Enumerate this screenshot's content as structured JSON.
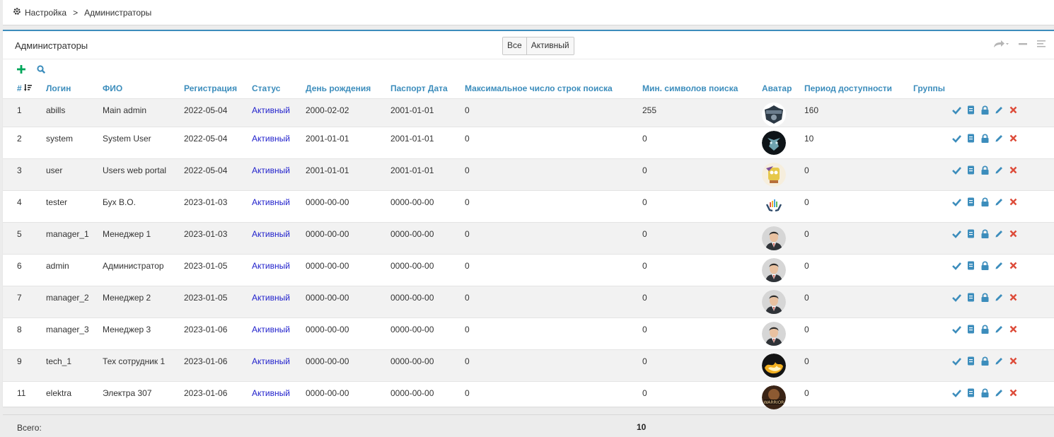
{
  "breadcrumb": {
    "root": "Настройка",
    "separator": ">",
    "current": "Администраторы"
  },
  "card": {
    "title": "Администраторы"
  },
  "filters": [
    {
      "label": "Все"
    },
    {
      "label": "Активный"
    }
  ],
  "columns": {
    "id": "#",
    "login": "Логин",
    "fio": "ФИО",
    "reg": "Регистрация",
    "status": "Статус",
    "birthday": "День рождения",
    "passport": "Паспорт Дата",
    "max_rows": "Максимальное число строк поиска",
    "min_chars": "Мин. символов поиска",
    "avatar": "Аватар",
    "period": "Период доступности",
    "groups": "Группы"
  },
  "rows": [
    {
      "id": "1",
      "login": "abills",
      "fio": "Main admin",
      "reg": "2022-05-04",
      "status": "Активный",
      "birthday": "2000-02-02",
      "passport": "2001-01-01",
      "max_rows": "0",
      "min_chars": "255",
      "avatar": "logo-avatar",
      "period": "160",
      "groups": ""
    },
    {
      "id": "2",
      "login": "system",
      "fio": "System User",
      "reg": "2022-05-04",
      "status": "Активный",
      "birthday": "2001-01-01",
      "passport": "2001-01-01",
      "max_rows": "0",
      "min_chars": "0",
      "avatar": "monster-avatar",
      "period": "10",
      "groups": ""
    },
    {
      "id": "3",
      "login": "user",
      "fio": "Users web portal",
      "reg": "2022-05-04",
      "status": "Активный",
      "birthday": "2001-01-01",
      "passport": "2001-01-01",
      "max_rows": "0",
      "min_chars": "0",
      "avatar": "sponge-avatar",
      "period": "0",
      "groups": ""
    },
    {
      "id": "4",
      "login": "tester",
      "fio": "Бух В.О.",
      "reg": "2023-01-03",
      "status": "Активный",
      "birthday": "0000-00-00",
      "passport": "0000-00-00",
      "max_rows": "0",
      "min_chars": "0",
      "avatar": "hands-avatar",
      "period": "0",
      "groups": ""
    },
    {
      "id": "5",
      "login": "manager_1",
      "fio": "Менеджер 1",
      "reg": "2023-01-03",
      "status": "Активный",
      "birthday": "0000-00-00",
      "passport": "0000-00-00",
      "max_rows": "0",
      "min_chars": "0",
      "avatar": "man-avatar",
      "period": "0",
      "groups": ""
    },
    {
      "id": "6",
      "login": "admin",
      "fio": "Администратор",
      "reg": "2023-01-05",
      "status": "Активный",
      "birthday": "0000-00-00",
      "passport": "0000-00-00",
      "max_rows": "0",
      "min_chars": "0",
      "avatar": "man-avatar",
      "period": "0",
      "groups": ""
    },
    {
      "id": "7",
      "login": "manager_2",
      "fio": "Менеджер 2",
      "reg": "2023-01-05",
      "status": "Активный",
      "birthday": "0000-00-00",
      "passport": "0000-00-00",
      "max_rows": "0",
      "min_chars": "0",
      "avatar": "man-avatar",
      "period": "0",
      "groups": ""
    },
    {
      "id": "8",
      "login": "manager_3",
      "fio": "Менеджер 3",
      "reg": "2023-01-06",
      "status": "Активный",
      "birthday": "0000-00-00",
      "passport": "0000-00-00",
      "max_rows": "0",
      "min_chars": "0",
      "avatar": "man-avatar",
      "period": "0",
      "groups": ""
    },
    {
      "id": "9",
      "login": "tech_1",
      "fio": "Тех сотрудник 1",
      "reg": "2023-01-06",
      "status": "Активный",
      "birthday": "0000-00-00",
      "passport": "0000-00-00",
      "max_rows": "0",
      "min_chars": "0",
      "avatar": "fire-avatar",
      "period": "0",
      "groups": ""
    },
    {
      "id": "11",
      "login": "elektra",
      "fio": "Электра 307",
      "reg": "2023-01-06",
      "status": "Активный",
      "birthday": "0000-00-00",
      "passport": "0000-00-00",
      "max_rows": "0",
      "min_chars": "0",
      "avatar": "warrior-avatar",
      "period": "0",
      "groups": ""
    }
  ],
  "footer": {
    "total_label": "Всего:",
    "total_value": "10"
  },
  "colors": {
    "accent": "#3c8dbc",
    "status_link": "#2222cc",
    "add_green": "#00a65a",
    "danger": "#dd4b39"
  }
}
